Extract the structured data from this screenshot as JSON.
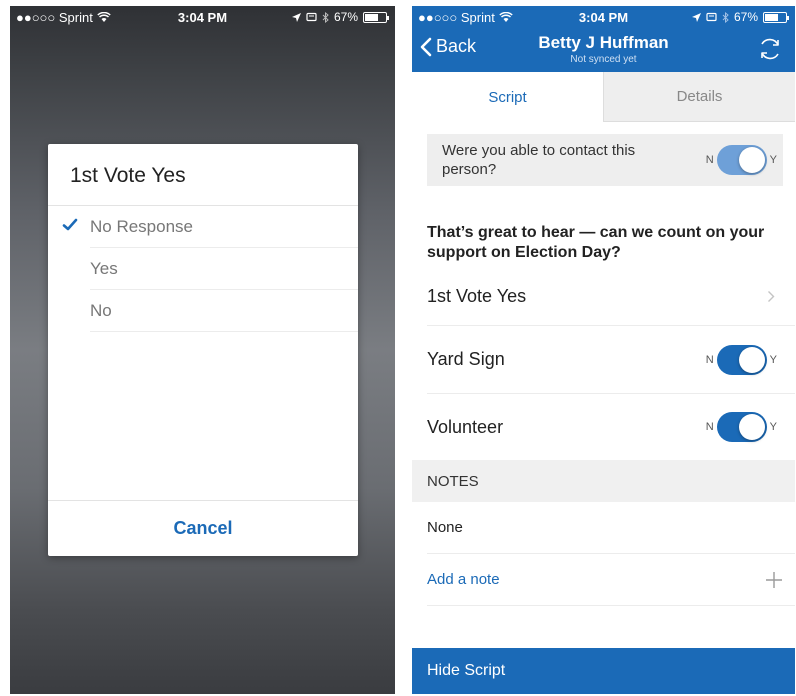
{
  "left": {
    "status": {
      "carrier": "●●○○○ Sprint",
      "time": "3:04 PM",
      "battery": "67%",
      "battery_level": 0.67
    },
    "dialog": {
      "title": "1st Vote Yes",
      "options": [
        {
          "label": "No Response",
          "selected": true
        },
        {
          "label": "Yes",
          "selected": false
        },
        {
          "label": "No",
          "selected": false
        }
      ],
      "cancel_label": "Cancel"
    }
  },
  "right": {
    "status": {
      "carrier": "●●○○○ Sprint",
      "time": "3:04 PM",
      "battery": "67%",
      "battery_level": 0.67
    },
    "header": {
      "back_label": "Back",
      "title": "Betty J Huffman",
      "subtitle": "Not synced yet"
    },
    "tabs": [
      {
        "label": "Script",
        "active": true
      },
      {
        "label": "Details",
        "active": false
      }
    ],
    "contact": {
      "question": "Were you able to contact this person?",
      "off_label": "N",
      "on_label": "Y",
      "value": "partial"
    },
    "prompt": "That’s great to hear — can we count on your support on Election Day?",
    "rows": {
      "vote": {
        "label": "1st Vote Yes"
      },
      "yard_sign": {
        "label": "Yard Sign",
        "off_label": "N",
        "on_label": "Y",
        "on": true
      },
      "volunteer": {
        "label": "Volunteer",
        "off_label": "N",
        "on_label": "Y",
        "on": true
      }
    },
    "notes": {
      "header": "NOTES",
      "value": "None",
      "add_label": "Add a note"
    },
    "footer": {
      "hide_script_label": "Hide Script"
    },
    "colors": {
      "brand": "#1b6ab7",
      "toggle_partial": "#6ea0d8"
    }
  }
}
